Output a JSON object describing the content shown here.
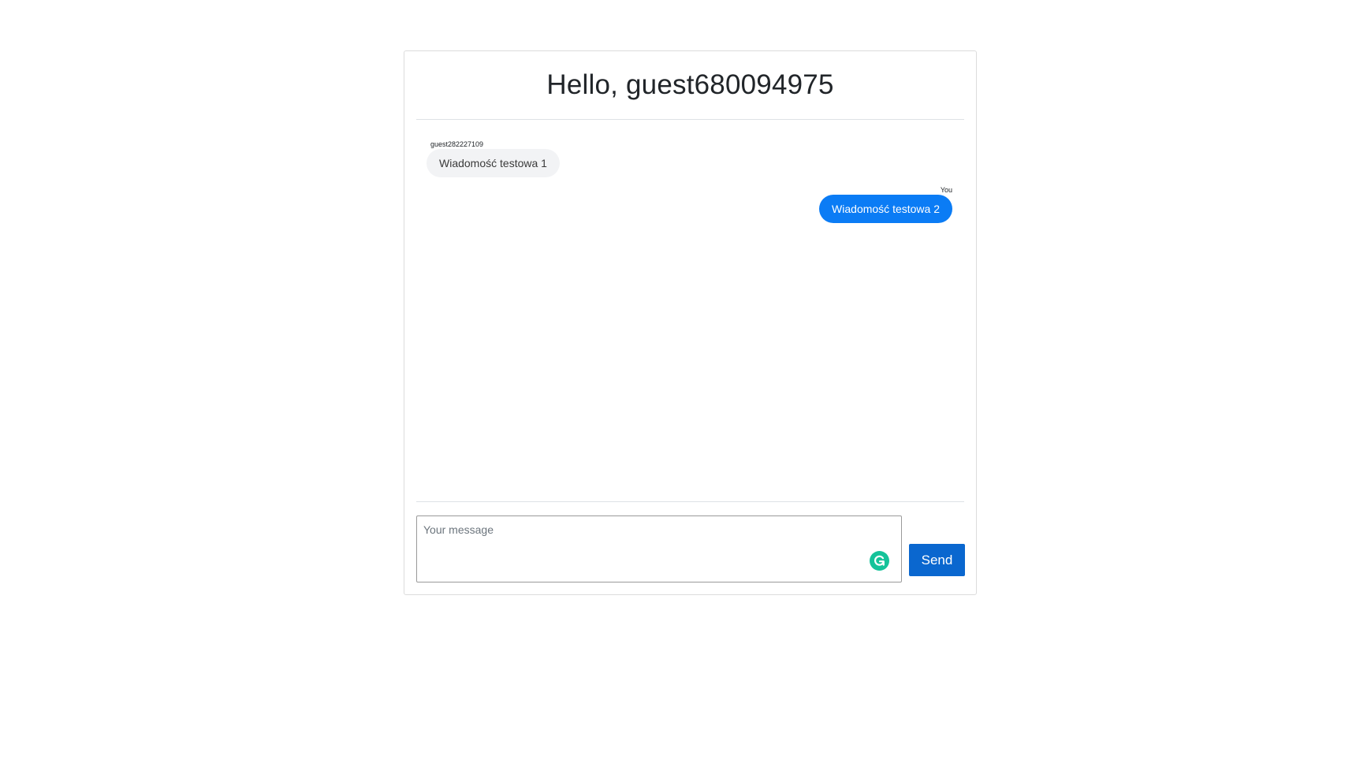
{
  "header": {
    "greeting": "Hello, guest680094975"
  },
  "messages": [
    {
      "author": "guest282227109",
      "text": "Wiadomość testowa 1",
      "own": false
    },
    {
      "author": "You",
      "text": "Wiadomość testowa 2",
      "own": true
    }
  ],
  "composer": {
    "placeholder": "Your message",
    "value": "",
    "send_label": "Send"
  },
  "icons": {
    "grammarly": "grammarly-icon"
  },
  "colors": {
    "own_bubble": "#0b7cf5",
    "other_bubble": "#f2f3f5",
    "send_button": "#0a67cf",
    "grammarly": "#15c39a"
  }
}
